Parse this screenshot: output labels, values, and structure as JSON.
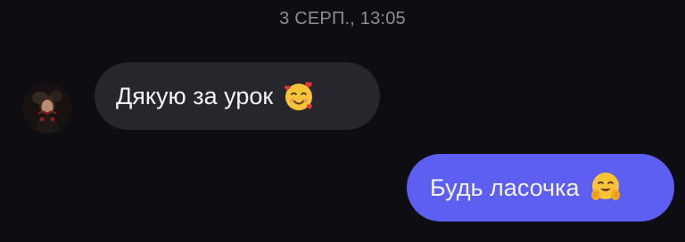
{
  "chat": {
    "timestamp": "3 СЕРП., 13:05",
    "messages": [
      {
        "direction": "incoming",
        "text": "Дякую за урок",
        "emoji": "smiling-face-with-hearts-icon",
        "bubble_color": "#26262c"
      },
      {
        "direction": "outgoing",
        "text": "Будь ласочка",
        "emoji": "hugging-face-icon",
        "bubble_color": "#5d5ef2"
      }
    ]
  },
  "colors": {
    "background": "#0d0d12",
    "timestamp_text": "#8d8e94",
    "message_text": "#f4f4f6"
  }
}
